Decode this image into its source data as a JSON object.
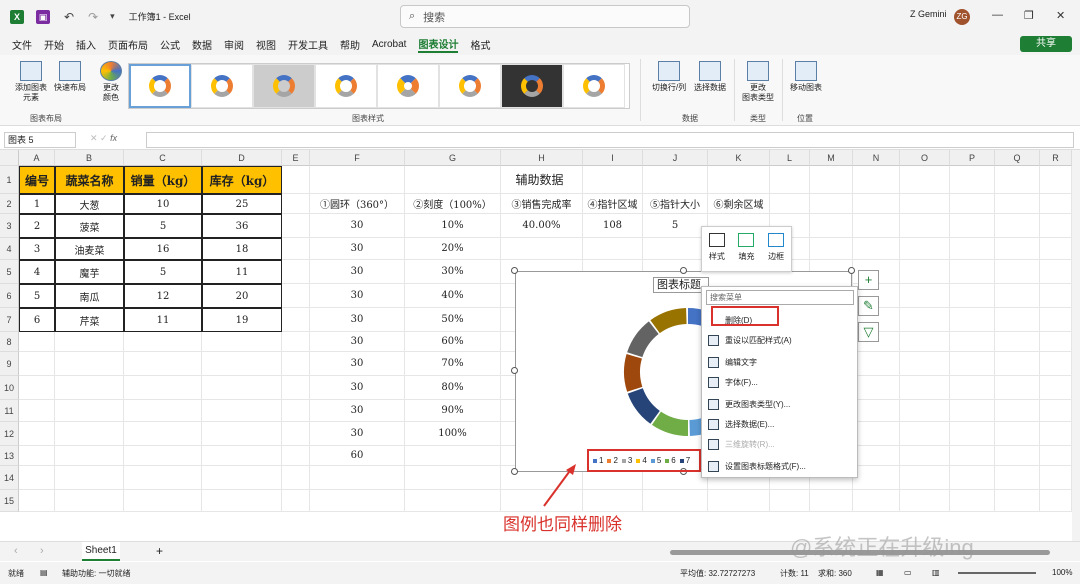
{
  "titlebar": {
    "autosave_icon": "excel-icon",
    "doc_title": "工作簿1 - Excel",
    "search_placeholder": "搜索",
    "user_name": "Z Gemini",
    "avatar_initials": "ZG"
  },
  "menu": [
    "文件",
    "开始",
    "插入",
    "页面布局",
    "公式",
    "数据",
    "审阅",
    "视图",
    "开发工具",
    "帮助",
    "Acrobat",
    "图表设计",
    "格式"
  ],
  "active_tab": "图表设计",
  "share_label": "共享",
  "ribbon": {
    "add_element": "添加图表\n元素",
    "quick_layout": "快速布局",
    "change_colors": "更改\n颜色",
    "group_layout": "图表布局",
    "group_styles": "图表样式",
    "switch_row_col": "切换行/列",
    "select_data": "选择数据",
    "group_data": "数据",
    "change_type": "更改\n图表类型",
    "group_type": "类型",
    "move_chart": "移动图表",
    "group_location": "位置"
  },
  "formula": {
    "name_box": "图表 5",
    "fx": "fx"
  },
  "columns": [
    "A",
    "B",
    "C",
    "D",
    "E",
    "F",
    "G",
    "H",
    "I",
    "J",
    "K",
    "L",
    "M",
    "N",
    "O",
    "P",
    "Q",
    "R"
  ],
  "rows": [
    "1",
    "2",
    "3",
    "4",
    "5",
    "6",
    "7",
    "8",
    "9",
    "10",
    "11",
    "12",
    "13",
    "14",
    "15"
  ],
  "table1": {
    "headers": [
      "编号",
      "蔬菜名称",
      "销量（kg）",
      "库存（kg）"
    ],
    "rows": [
      [
        "1",
        "大葱",
        "10",
        "25"
      ],
      [
        "2",
        "菠菜",
        "5",
        "36"
      ],
      [
        "3",
        "油麦菜",
        "16",
        "18"
      ],
      [
        "4",
        "魔芋",
        "5",
        "11"
      ],
      [
        "5",
        "南瓜",
        "12",
        "20"
      ],
      [
        "6",
        "芹菜",
        "11",
        "19"
      ]
    ]
  },
  "aux": {
    "title": "辅助数据",
    "headers": [
      "①圆环（360°）",
      "②刻度（100%）",
      "③销售完成率",
      "④指针区域",
      "⑤指针大小",
      "⑥剩余区域"
    ],
    "row1": [
      "30",
      "10%",
      "40.00%",
      "108",
      "5"
    ],
    "col_f": [
      "30",
      "30",
      "30",
      "30",
      "30",
      "30",
      "30",
      "30",
      "30",
      "60"
    ],
    "col_g": [
      "20%",
      "30%",
      "40%",
      "50%",
      "60%",
      "70%",
      "80%",
      "90%",
      "100%"
    ]
  },
  "chart": {
    "title": "图表标题",
    "legend": [
      "1",
      "2",
      "3",
      "4",
      "5",
      "6",
      "7"
    ],
    "chart_data": {
      "type": "pie",
      "categories": [
        "1",
        "2",
        "3",
        "4",
        "5",
        "6",
        "7"
      ],
      "values": [
        30,
        30,
        30,
        30,
        30,
        30,
        30
      ]
    },
    "colors": [
      "#4472c4",
      "#ed7d31",
      "#a5a5a5",
      "#ffc000",
      "#5b9bd5",
      "#70ad47",
      "#264478",
      "#9e480e",
      "#636363",
      "#997300"
    ]
  },
  "minibar": {
    "style": "样式",
    "fill": "填充",
    "border": "边框"
  },
  "context_menu": {
    "search": "搜索菜单",
    "items": [
      "删除(D)",
      "重设以匹配样式(A)",
      "编辑文字",
      "字体(F)...",
      "更改图表类型(Y)...",
      "选择数据(E)...",
      "三维旋转(R)...",
      "设置图表标题格式(F)..."
    ]
  },
  "annotation": "图例也同样删除",
  "sheet": {
    "tab": "Sheet1",
    "add": "+"
  },
  "status": {
    "ready": "就绪",
    "access": "辅助功能: 一切就绪",
    "avg": "平均值: 32.72727273",
    "count": "计数: 11",
    "sum": "求和: 360",
    "zoom": "100%"
  },
  "watermark": "@系统正在升级ing"
}
